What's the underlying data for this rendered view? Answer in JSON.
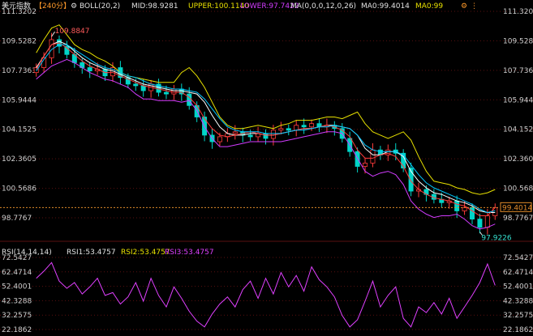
{
  "header": {
    "instrument": "美元指数",
    "period": "【240分】",
    "settings_icon": "gear-icon",
    "boll": "BOLL(20,2)",
    "mid": "MID:98.9281",
    "upper": "UPPER:100.1140",
    "lower": "LOWER:97.7422",
    "ma": "MA(0,0,0,12,0,26)",
    "ma0": "MA0:99.4014",
    "ma0b": "MA0:99"
  },
  "rsi_header": {
    "label": "RSI(14,14,14)",
    "rsi1": "RSI1:53.4757",
    "rsi2": "RSI2:53.4757",
    "rsi3": "RSI3:53.4757"
  },
  "main_ticks": [
    "111.3202",
    "109.5282",
    "107.7363",
    "105.9444",
    "104.1525",
    "102.3605",
    "100.5686",
    "98.7767"
  ],
  "rsi_ticks": [
    "72.5427",
    "62.4714",
    "52.4001",
    "42.3288",
    "32.2575",
    "22.1862"
  ],
  "annotations": {
    "high": "109.8847",
    "low": "97.9226",
    "last": "99.4014"
  },
  "colors": {
    "up": "#ff3b3b",
    "down": "#00d5c8",
    "mid": "#ffffff",
    "upper": "#e7e000",
    "lower": "#d23cff",
    "ma12": "#ff3b3b",
    "ma26": "#00c8ff",
    "rsi": "#e040ff",
    "grid": "#5a1010",
    "last": "#e08a2a"
  },
  "chart_data": [
    {
      "type": "candlestick",
      "title": "美元指数【240分】",
      "ylim": [
        97.5,
        111.3202
      ],
      "series": [
        {
          "name": "MID",
          "values": [
            107.9,
            108.6,
            109.3,
            109.5,
            109.3,
            108.9,
            108.5,
            108.2,
            108.0,
            107.8,
            107.7,
            107.5,
            107.3,
            107.1,
            106.9,
            106.8,
            106.7,
            106.6,
            106.5,
            106.5,
            106.4,
            106.3,
            105.8,
            105.0,
            104.3,
            103.9,
            103.8,
            103.8,
            103.9,
            103.9,
            103.8,
            103.8,
            103.9,
            104.0,
            104.1,
            104.2,
            104.2,
            104.3,
            104.4,
            104.4,
            104.3,
            104.2,
            103.8,
            103.0,
            102.6,
            102.6,
            102.8,
            102.8,
            102.5,
            101.6,
            101.0,
            100.6,
            100.3,
            100.2,
            100.0,
            99.8,
            99.7,
            99.5,
            99.2,
            99.1,
            99.1
          ]
        },
        {
          "name": "UPPER",
          "values": [
            108.8,
            109.6,
            110.3,
            110.5,
            109.9,
            109.3,
            109.0,
            108.8,
            108.5,
            108.3,
            108.0,
            107.6,
            107.4,
            107.3,
            107.2,
            107.1,
            107.0,
            107.0,
            107.0,
            107.6,
            107.9,
            107.4,
            106.7,
            105.8,
            104.9,
            104.4,
            104.2,
            104.2,
            104.3,
            104.4,
            104.3,
            104.2,
            104.4,
            104.5,
            104.7,
            104.7,
            104.7,
            104.8,
            104.9,
            104.9,
            104.8,
            105.0,
            105.2,
            104.5,
            104.0,
            103.8,
            103.6,
            103.8,
            104.0,
            103.5,
            102.5,
            101.6,
            101.0,
            100.9,
            100.8,
            100.6,
            100.5,
            100.3,
            100.2,
            100.3,
            100.5
          ]
        },
        {
          "name": "LOWER",
          "values": [
            107.2,
            107.6,
            108.0,
            108.2,
            108.4,
            108.2,
            107.9,
            107.6,
            107.4,
            107.2,
            107.1,
            106.9,
            106.7,
            106.3,
            106.0,
            106.0,
            105.9,
            105.9,
            105.9,
            105.8,
            105.9,
            105.3,
            104.3,
            103.6,
            103.1,
            103.1,
            103.2,
            103.3,
            103.4,
            103.4,
            103.4,
            103.4,
            103.4,
            103.5,
            103.6,
            103.7,
            103.8,
            103.9,
            104.0,
            104.0,
            103.9,
            103.2,
            102.4,
            101.6,
            101.3,
            101.5,
            101.6,
            101.4,
            100.8,
            99.8,
            99.3,
            99.0,
            98.8,
            98.9,
            98.9,
            99.0,
            98.7,
            98.3,
            98.1,
            98.2,
            98.4
          ]
        },
        {
          "name": "MA12",
          "values": [
            107.8,
            108.6,
            109.3,
            109.4,
            109.1,
            108.7,
            108.3,
            108.0,
            107.8,
            107.6,
            107.6,
            107.4,
            107.2,
            107.0,
            106.8,
            106.7,
            106.6,
            106.5,
            106.4,
            106.4,
            106.1,
            105.6,
            104.8,
            104.2,
            103.8,
            103.7,
            103.8,
            103.9,
            104.0,
            103.9,
            103.8,
            103.8,
            103.9,
            104.0,
            104.1,
            104.2,
            104.2,
            104.3,
            104.4,
            104.3,
            104.1,
            103.7,
            102.9,
            102.4,
            102.4,
            102.6,
            102.7,
            102.5,
            101.9,
            101.0,
            100.5,
            100.2,
            100.0,
            99.9,
            99.8,
            99.6,
            99.5,
            99.2,
            98.9,
            98.9,
            99.4
          ]
        },
        {
          "name": "MA26",
          "values": [
            107.7,
            108.4,
            109.0,
            109.3,
            109.3,
            109.0,
            108.7,
            108.4,
            108.1,
            107.9,
            107.8,
            107.6,
            107.4,
            107.3,
            107.1,
            106.9,
            106.8,
            106.7,
            106.6,
            106.6,
            106.5,
            106.4,
            106.0,
            105.4,
            104.8,
            104.3,
            104.1,
            104.0,
            104.0,
            104.0,
            103.9,
            103.9,
            103.9,
            104.0,
            104.1,
            104.1,
            104.2,
            104.3,
            104.3,
            104.4,
            104.3,
            104.2,
            103.8,
            103.2,
            102.9,
            102.8,
            102.8,
            102.8,
            102.6,
            102.0,
            101.4,
            100.9,
            100.6,
            100.4,
            100.2,
            100.0,
            99.8,
            99.6,
            99.3,
            99.1,
            99.2
          ]
        }
      ],
      "candles": [
        107.9,
        108.5,
        109.6,
        109.2,
        108.7,
        108.2,
        107.9,
        107.7,
        107.8,
        107.4,
        107.9,
        107.3,
        106.9,
        106.8,
        106.5,
        106.9,
        106.4,
        106.3,
        106.6,
        106.3,
        105.6,
        104.9,
        103.8,
        103.4,
        103.7,
        103.9,
        104.0,
        103.8,
        103.7,
        103.9,
        103.6,
        104.1,
        104.2,
        104.1,
        104.4,
        104.3,
        104.5,
        104.3,
        104.4,
        104.2,
        103.6,
        102.8,
        101.9,
        102.1,
        102.9,
        102.6,
        102.9,
        102.7,
        101.8,
        100.4,
        100.5,
        100.2,
        99.9,
        99.7,
        99.8,
        99.2,
        99.4,
        98.7,
        98.2,
        98.9,
        99.4
      ]
    },
    {
      "type": "line",
      "title": "RSI(14,14,14)",
      "ylim": [
        22.1862,
        72.5427
      ],
      "series": [
        {
          "name": "RSI1",
          "values": [
            58,
            63,
            69,
            56,
            51,
            55,
            47,
            52,
            58,
            46,
            48,
            40,
            45,
            55,
            42,
            58,
            46,
            38,
            52,
            44,
            35,
            28,
            24,
            33,
            40,
            45,
            38,
            50,
            56,
            44,
            58,
            47,
            62,
            52,
            60,
            49,
            66,
            57,
            52,
            45,
            32,
            24,
            29,
            42,
            56,
            38,
            46,
            52,
            30,
            24,
            38,
            34,
            41,
            33,
            44,
            30,
            38,
            46,
            55,
            68,
            53
          ]
        }
      ]
    }
  ]
}
